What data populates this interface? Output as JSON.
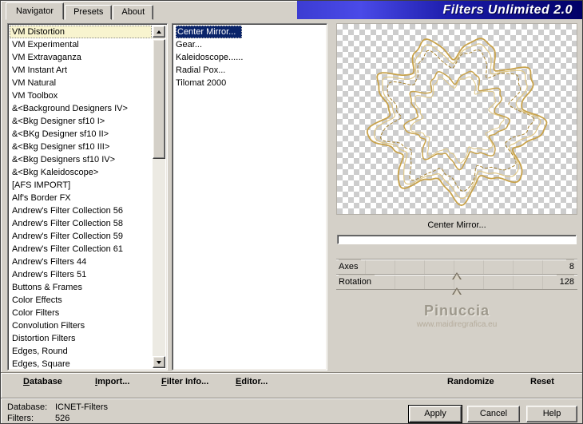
{
  "banner": {
    "title": "Filters Unlimited 2.0"
  },
  "tabs": [
    {
      "label": "Navigator",
      "active": true
    },
    {
      "label": "Presets",
      "active": false
    },
    {
      "label": "About",
      "active": false
    }
  ],
  "categories": {
    "selected_index": 0,
    "items": [
      "VM Distortion",
      "VM Experimental",
      "VM Extravaganza",
      "VM Instant Art",
      "VM Natural",
      "VM Toolbox",
      "&<Background Designers IV>",
      "&<Bkg Designer sf10 I>",
      "&<BKg Designer sf10 II>",
      "&<Bkg Designer sf10 III>",
      "&<Bkg Designers sf10 IV>",
      "&<Bkg Kaleidoscope>",
      "[AFS IMPORT]",
      "Alf's Border FX",
      "Andrew's Filter Collection 56",
      "Andrew's Filter Collection 58",
      "Andrew's Filter Collection 59",
      "Andrew's Filter Collection 61",
      "Andrew's Filters 44",
      "Andrew's Filters 51",
      "Buttons & Frames",
      "Color Effects",
      "Color Filters",
      "Convolution Filters",
      "Distortion Filters",
      "Edges, Round",
      "Edges, Square"
    ]
  },
  "filters": {
    "selected_index": 0,
    "items": [
      "Center Mirror...",
      "Gear...",
      "Kaleidoscope......",
      "Radial Pox...",
      "Tilomat 2000"
    ]
  },
  "preview": {
    "filter_label": "Center Mirror...",
    "watermark_title": "Pinuccia",
    "watermark_url": "www.maidiregrafica.eu",
    "ornament_colors": [
      "#c8a24a",
      "#e0c887",
      "#a8832f"
    ]
  },
  "sliders": [
    {
      "label": "Axes",
      "value": "8",
      "thumb_pct": 50
    },
    {
      "label": "Rotation",
      "value": "128",
      "thumb_pct": 50
    }
  ],
  "toolbar": {
    "left": [
      {
        "label": "Database",
        "underline": 0
      },
      {
        "label": "Import...",
        "underline": 0
      },
      {
        "label": "Filter Info...",
        "underline": 0
      },
      {
        "label": "Editor...",
        "underline": 0
      }
    ],
    "right": [
      {
        "label": "Randomize",
        "underline": -1
      },
      {
        "label": "Reset",
        "underline": -1
      }
    ]
  },
  "status": {
    "database_label": "Database:",
    "database_value": "ICNET-Filters",
    "filters_label": "Filters:",
    "filters_value": "526"
  },
  "action_buttons": [
    {
      "label": "Apply",
      "default": true
    },
    {
      "label": "Cancel",
      "default": false
    },
    {
      "label": "Help",
      "default": false
    }
  ]
}
